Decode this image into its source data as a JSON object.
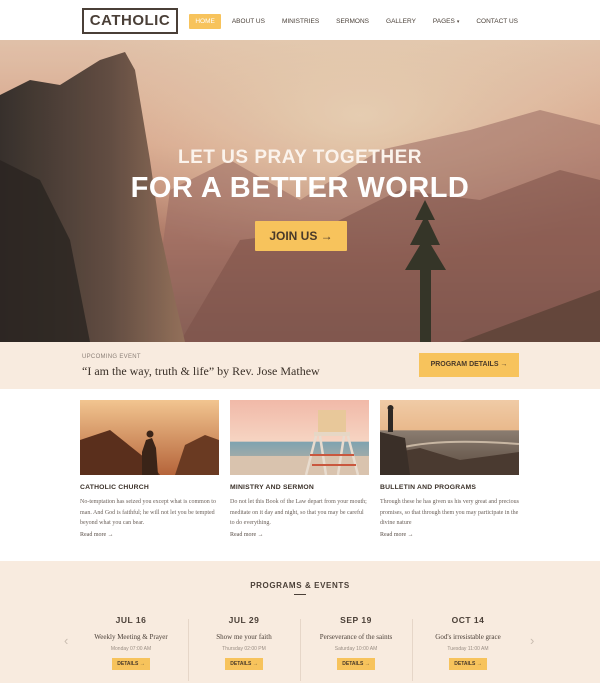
{
  "header": {
    "logo": "CATHOLIC",
    "nav": [
      {
        "label": "HOME",
        "active": true
      },
      {
        "label": "ABOUT US"
      },
      {
        "label": "MINISTRIES"
      },
      {
        "label": "SERMONS"
      },
      {
        "label": "GALLERY"
      },
      {
        "label": "PAGES",
        "caret": "▾"
      },
      {
        "label": "CONTACT US"
      }
    ]
  },
  "hero": {
    "line1": "LET US PRAY TOGETHER",
    "line2": "FOR A BETTER WORLD",
    "button": "JOIN US →"
  },
  "event": {
    "label": "UPCOMING EVENT",
    "quote": "“I am the way, truth & life” by Rev. Jose Mathew",
    "button": "PROGRAM DETAILS  →"
  },
  "cards": [
    {
      "title": "CATHOLIC CHURCH",
      "text": "No-temptation has seized you except what is common to man. And God is faithful; he will not let you be tempted beyond what you can bear.",
      "more": "Read more →"
    },
    {
      "title": "MINISTRY AND SERMON",
      "text": "Do not let this Book of the Law depart from your mouth; meditate on it day and night, so that you may be careful to do everything.",
      "more": "Read more →"
    },
    {
      "title": "BULLETIN AND PROGRAMS",
      "text": "Through these he has given us his very great and precious promises, so that through them you may participate in the divine nature",
      "more": "Read more →"
    }
  ],
  "programs": {
    "title": "PROGRAMS & EVENTS",
    "prev": "‹",
    "next": "›",
    "items": [
      {
        "date": "JUL 16",
        "name": "Weekly Meeting & Prayer",
        "time": "Monday 07:00 AM",
        "button": "DETAILS →"
      },
      {
        "date": "JUL 29",
        "name": "Show me your faith",
        "time": "Thursday 02:00 PM",
        "button": "DETAILS →"
      },
      {
        "date": "SEP 19",
        "name": "Perseverance of the saints",
        "time": "Saturday 10:00 AM",
        "button": "DETAILS →"
      },
      {
        "date": "OCT 14",
        "name": "God's irresistable grace",
        "time": "Tuesday 11:00 AM",
        "button": "DETAILS →"
      }
    ]
  },
  "colors": {
    "accent": "#f7c35c",
    "strip": "#f8ebdf",
    "text_dark": "#3a3028"
  }
}
